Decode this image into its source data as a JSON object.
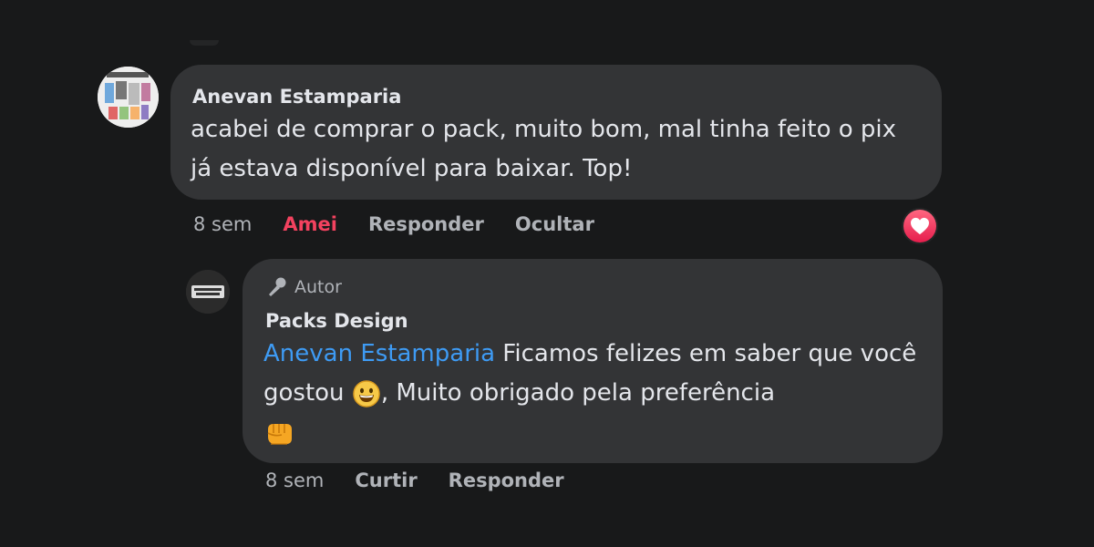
{
  "comment": {
    "author": "Anevan Estamparia",
    "text": "acabei de comprar o pack, muito bom, mal tinha feito o pix já estava disponível para baixar. Top!",
    "time": "8 sem",
    "actions": {
      "love": "Amei",
      "reply": "Responder",
      "hide": "Ocultar"
    },
    "reaction_icon": "heart-reaction-icon"
  },
  "reply": {
    "badge": "Autor",
    "badge_icon": "microphone-icon",
    "author": "Packs Design",
    "mention": "Anevan Estamparia",
    "text_part1": " Ficamos felizes em saber que você gostou ",
    "emoji1": "grinning-face-emoji",
    "text_part2": ", Muito obrigado pela preferência",
    "emoji2": "oncoming-fist-emoji",
    "time": "8 sem",
    "actions": {
      "like": "Curtir",
      "reply": "Responder"
    }
  },
  "colors": {
    "background": "#18191a",
    "bubble": "#333436",
    "mention": "#3e9bf4",
    "love": "#f3425f"
  }
}
